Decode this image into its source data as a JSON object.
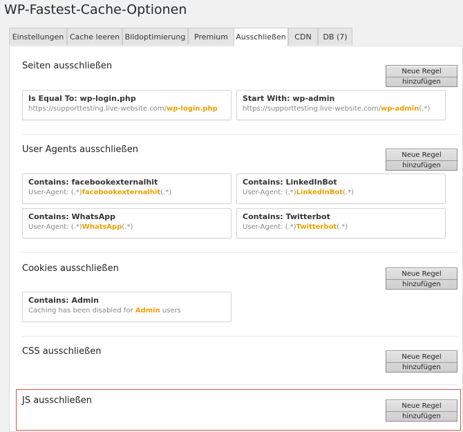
{
  "page_title": "WP-Fastest-Cache-Optionen",
  "tabs": [
    {
      "label": "Einstellungen",
      "active": false
    },
    {
      "label": "Cache leeren",
      "active": false
    },
    {
      "label": "Bildoptimierung",
      "active": false
    },
    {
      "label": "Premium",
      "active": false
    },
    {
      "label": "Ausschließen",
      "active": true
    },
    {
      "label": "CDN",
      "active": false
    },
    {
      "label": "DB (7)",
      "active": false
    }
  ],
  "new_rule": {
    "line1": "Neue Regel",
    "line2": "hinzufügen"
  },
  "sections": {
    "pages": {
      "title": "Seiten ausschließen",
      "rules": [
        {
          "title": "Is Equal To: wp-login.php",
          "prefix": "https://supporttesting.live-website.com/",
          "highlight": "wp-login.php",
          "suffix": ""
        },
        {
          "title": "Start With: wp-admin",
          "prefix": "https://supporttesting.live-website.com/",
          "highlight": "wp-admin",
          "suffix": "(.*)"
        }
      ]
    },
    "user_agents": {
      "title": "User Agents ausschließen",
      "rules": [
        {
          "title": "Contains: facebookexternalhit",
          "prefix": "User-Agent: (.*)",
          "highlight": "facebookexternalhit",
          "suffix": "(.*)"
        },
        {
          "title": "Contains: LinkedInBot",
          "prefix": "User-Agent: (.*)",
          "highlight": "LinkedInBot",
          "suffix": "(.*)"
        },
        {
          "title": "Contains: WhatsApp",
          "prefix": "User-Agent: (.*)",
          "highlight": "WhatsApp",
          "suffix": "(.*)"
        },
        {
          "title": "Contains: Twitterbot",
          "prefix": "User-Agent: (.*)",
          "highlight": "Twitterbot",
          "suffix": "(.*)"
        }
      ]
    },
    "cookies": {
      "title": "Cookies ausschließen",
      "rules": [
        {
          "title": "Contains: Admin",
          "prefix": "Caching has been disabled for ",
          "highlight": "Admin",
          "suffix": " users"
        }
      ]
    },
    "css": {
      "title": "CSS ausschließen"
    },
    "js": {
      "title": "JS ausschließen"
    }
  },
  "colors": {
    "highlight": "#f0a000",
    "selection_border": "#d9534f"
  }
}
